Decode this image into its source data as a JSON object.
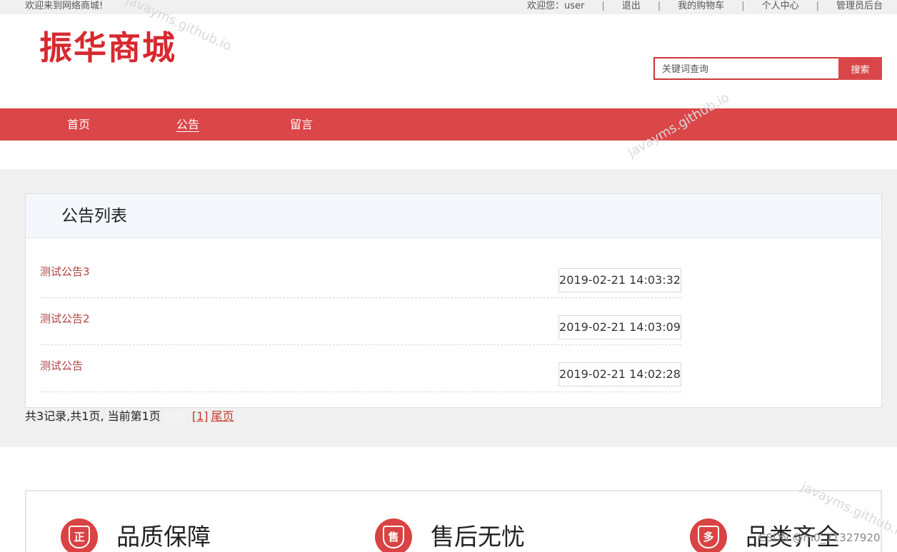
{
  "topbar": {
    "welcome": "欢迎来到网络商城!",
    "user_label": "欢迎您：user",
    "logout": "退出",
    "cart": "我的购物车",
    "profile": "个人中心",
    "admin": "管理员后台"
  },
  "header": {
    "logo": "振华商城",
    "search_placeholder": "关键词查询",
    "search_button": "搜索"
  },
  "nav": {
    "items": [
      "首页",
      "公告",
      "留言"
    ],
    "active": "公告"
  },
  "notice_panel": {
    "title": "公告列表",
    "items": [
      {
        "title": "测试公告3",
        "date": "2019-02-21 14:03:32"
      },
      {
        "title": "测试公告2",
        "date": "2019-02-21 14:03:09"
      },
      {
        "title": "测试公告",
        "date": "2019-02-21 14:02:28"
      }
    ]
  },
  "pagination": {
    "summary": "共3记录,共1页, 当前第1页",
    "first": "首页",
    "current": "[1]",
    "last": "尾页"
  },
  "features": [
    {
      "icon": "quality-shield-icon",
      "glyph": "正",
      "label": "品质保障"
    },
    {
      "icon": "after-sales-shield-icon",
      "glyph": "售",
      "label": "售后无忧"
    },
    {
      "icon": "variety-shield-icon",
      "glyph": "多",
      "label": "品类齐全"
    }
  ],
  "watermark": "javayms.github.io",
  "credit": "CSDN @m0_71327920",
  "colors": {
    "brand_red": "#d8282f",
    "nav_red": "#db4648",
    "link_red": "#b04040"
  }
}
